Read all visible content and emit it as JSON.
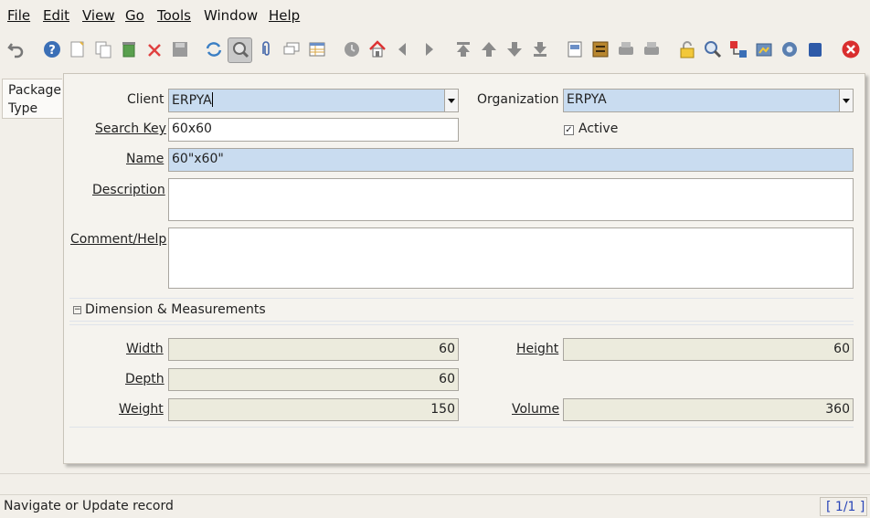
{
  "menu": [
    {
      "label": "File"
    },
    {
      "label": "Edit"
    },
    {
      "label": "View"
    },
    {
      "label": "Go"
    },
    {
      "label": "Tools"
    },
    {
      "label": "Window"
    },
    {
      "label": "Help"
    }
  ],
  "toolbar_icons": [
    "undo",
    "help",
    "new-record",
    "copy-record",
    "delete",
    "delete-selection",
    "save",
    "refresh",
    "find",
    "attachment",
    "chat",
    "grid-toggle",
    "history",
    "home",
    "back",
    "forward",
    "first-record",
    "previous-record",
    "next-record",
    "last-record",
    "report",
    "archive",
    "print-preview",
    "print",
    "lock",
    "zoom-across",
    "request",
    "product-info",
    "workflow",
    "end"
  ],
  "tab": {
    "label_line1": "Package",
    "label_line2": "Type"
  },
  "form": {
    "client": {
      "label": "Client",
      "value": "ERPYA"
    },
    "organization": {
      "label": "Organization",
      "value": "ERPYA"
    },
    "search_key": {
      "label": "Search Key",
      "value": "60x60"
    },
    "active": {
      "label": "Active",
      "checked": true
    },
    "name": {
      "label": "Name",
      "value": "60\"x60\""
    },
    "description": {
      "label": "Description",
      "value": ""
    },
    "comment_help": {
      "label": "Comment/Help",
      "value": ""
    }
  },
  "group": {
    "title": "Dimension & Measurements",
    "collapsed": false,
    "width": {
      "label": "Width",
      "value": "60"
    },
    "height": {
      "label": "Height",
      "value": "60"
    },
    "depth": {
      "label": "Depth",
      "value": "60"
    },
    "weight": {
      "label": "Weight",
      "value": "150"
    },
    "volume": {
      "label": "Volume",
      "value": "360"
    }
  },
  "status": {
    "message": "Navigate or Update record",
    "record": "[ 1/1 ]"
  },
  "colors": {
    "mandatory": "#c9dcf0",
    "readonly": "#ecebdd",
    "record_text": "#2a46b8"
  }
}
